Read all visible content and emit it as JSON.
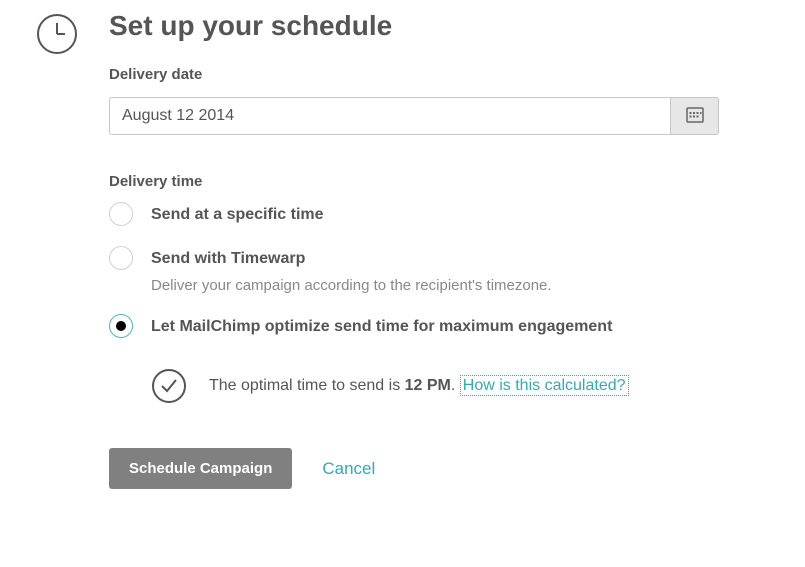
{
  "heading": "Set up your schedule",
  "delivery_date": {
    "label": "Delivery date",
    "value": "August 12 2014"
  },
  "delivery_time": {
    "label": "Delivery time",
    "options": [
      {
        "label": "Send at a specific time",
        "desc": ""
      },
      {
        "label": "Send with Timewarp",
        "desc": "Deliver your campaign according to the recipient's timezone."
      },
      {
        "label": "Let MailChimp optimize send time for maximum engagement",
        "desc": ""
      }
    ],
    "selected_index": 2
  },
  "optimal": {
    "prefix": "The optimal time to send is ",
    "time": "12 PM",
    "suffix": ". ",
    "link": "How is this calculated?"
  },
  "actions": {
    "primary": "Schedule Campaign",
    "cancel": "Cancel"
  }
}
